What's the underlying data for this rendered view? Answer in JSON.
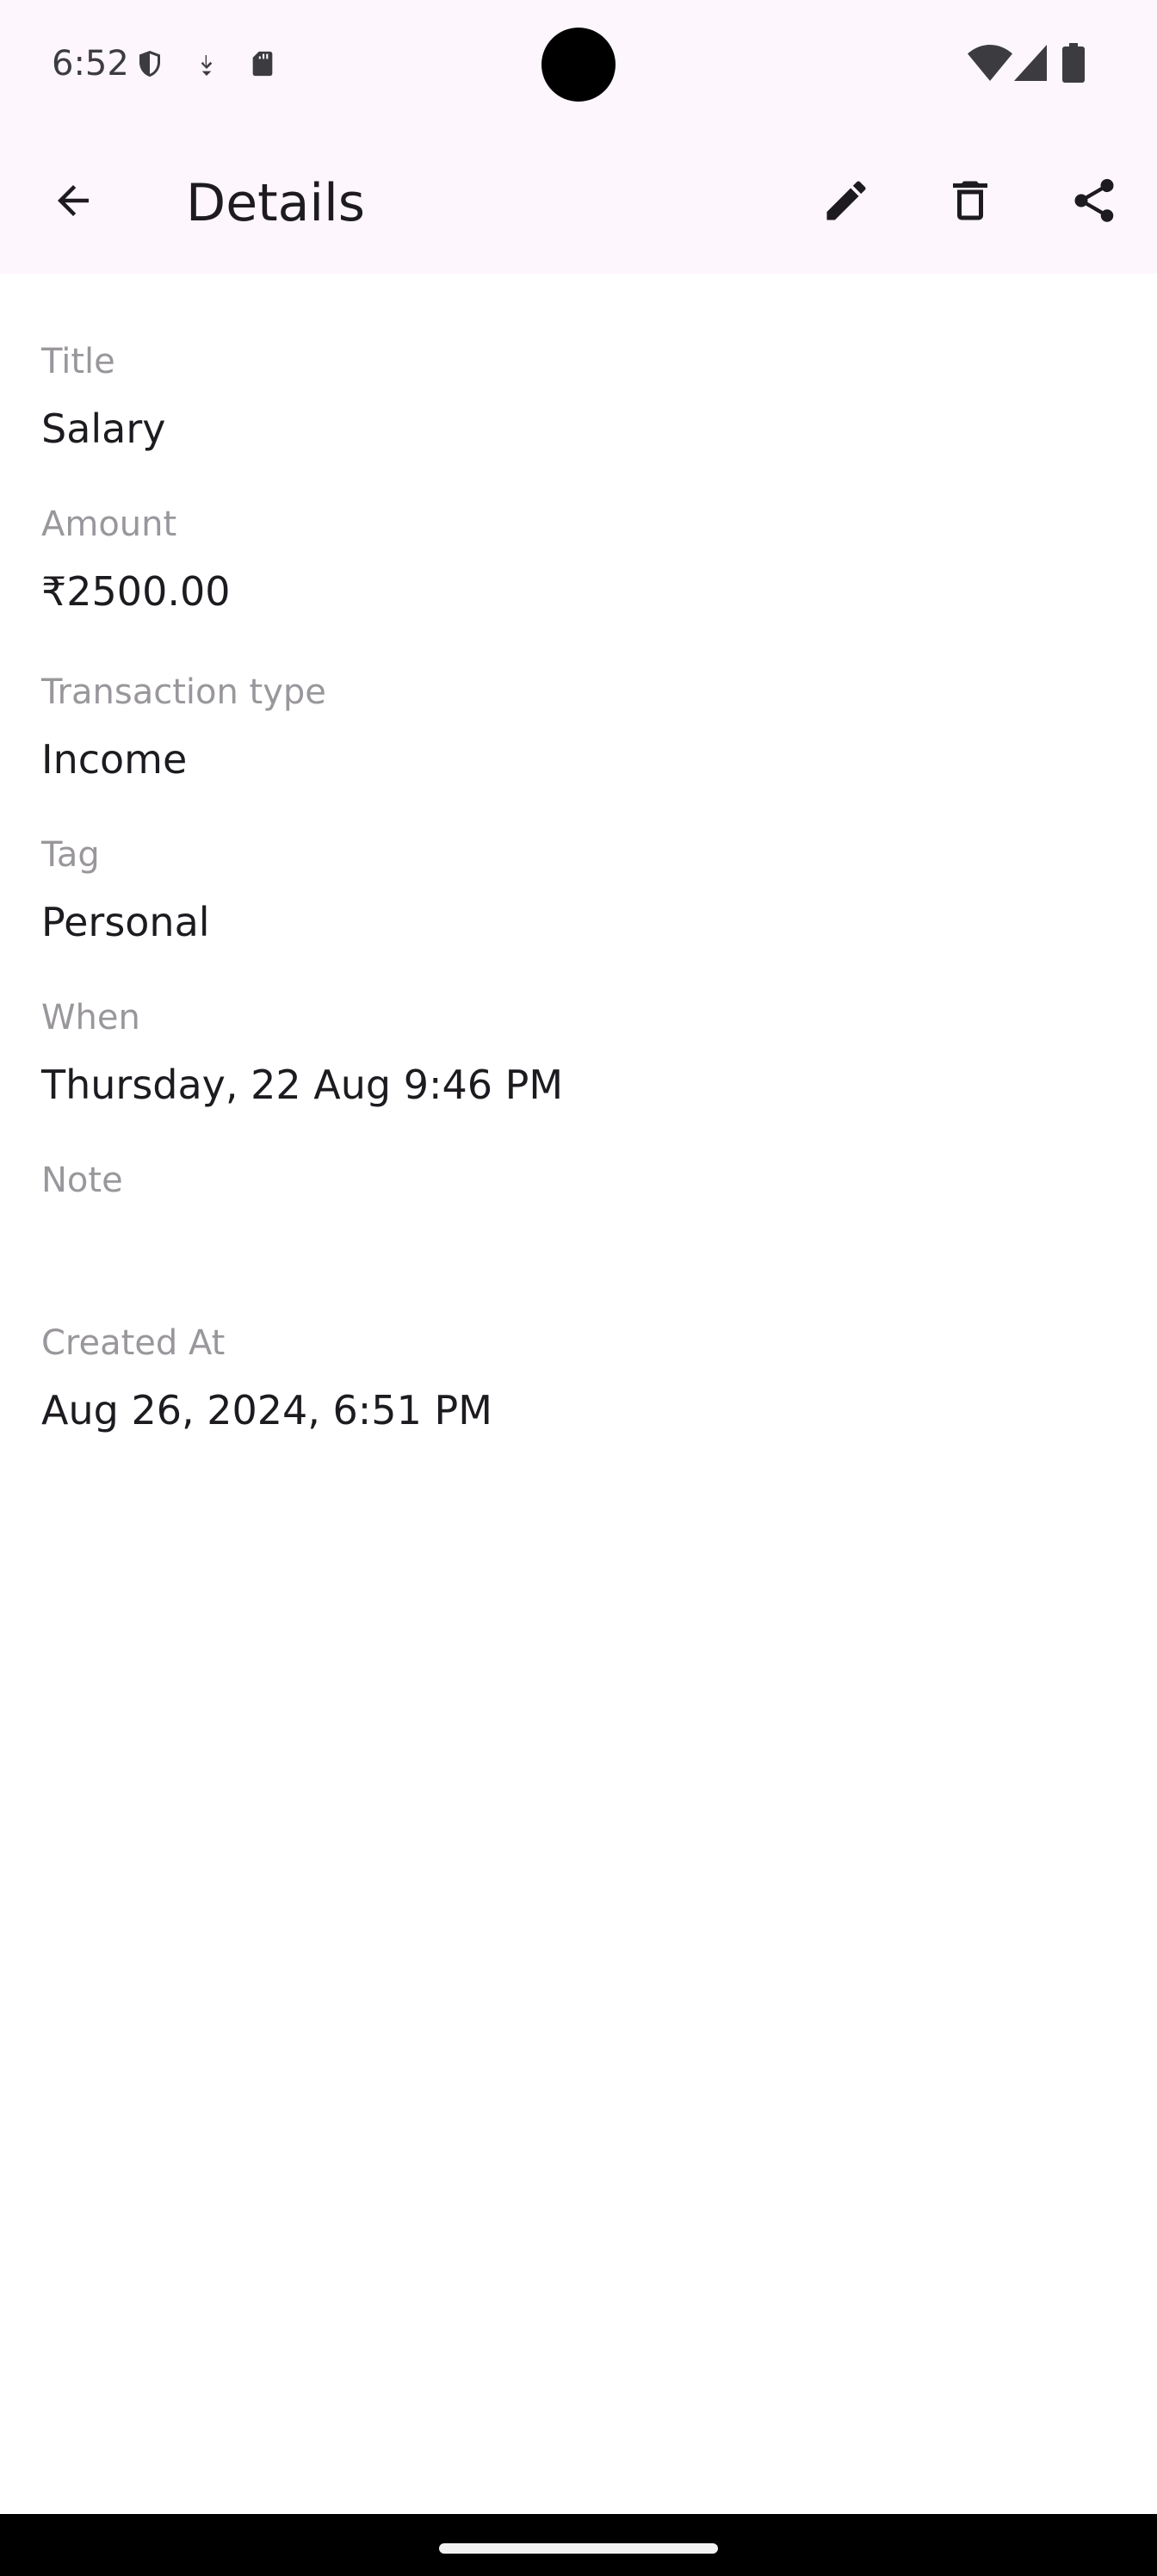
{
  "status_bar": {
    "time": "6:52",
    "icons_left": [
      "shield-icon",
      "download-icon",
      "sd-card-icon"
    ],
    "icons_right": [
      "wifi-icon",
      "signal-icon",
      "battery-icon"
    ]
  },
  "app_bar": {
    "title": "Details",
    "back_icon": "arrow-back-icon",
    "actions": [
      "edit-icon",
      "delete-icon",
      "share-icon"
    ],
    "background": "#fdf6fc"
  },
  "details": {
    "title": {
      "label": "Title",
      "value": "Salary"
    },
    "amount": {
      "label": "Amount",
      "value": "₹2500.00"
    },
    "transaction_type": {
      "label": "Transaction type",
      "value": "Income"
    },
    "tag": {
      "label": "Tag",
      "value": "Personal"
    },
    "when": {
      "label": "When",
      "value": "Thursday, 22 Aug 9:46 PM"
    },
    "note": {
      "label": "Note",
      "value": ""
    },
    "created_at": {
      "label": "Created At",
      "value": "Aug 26, 2024, 6:51 PM"
    }
  },
  "colors": {
    "label": "#9a979c",
    "value": "#1d1b20",
    "icon": "#1d1b20"
  }
}
